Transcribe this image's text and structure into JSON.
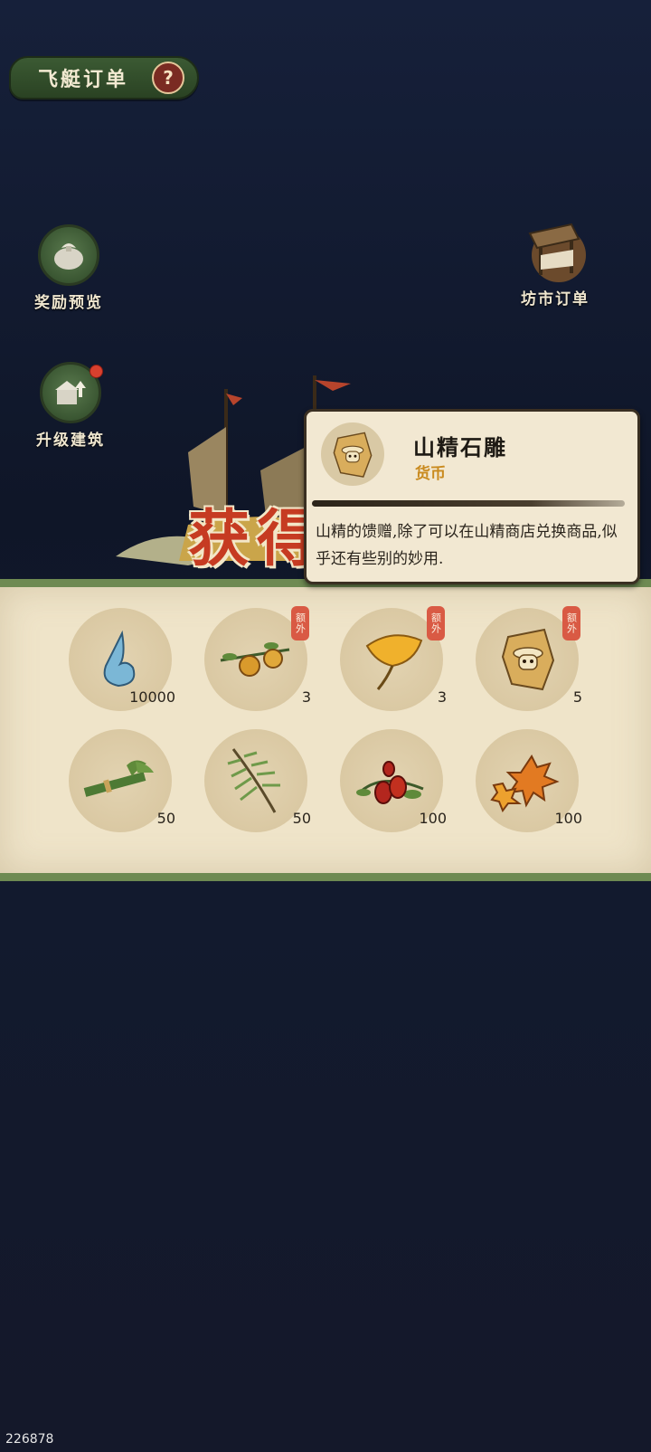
{
  "header": {
    "title": "飞艇订单",
    "help_symbol": "?"
  },
  "side_buttons": {
    "reward_preview": "奖励预览",
    "upgrade_building": "升级建筑",
    "market_orders": "坊市订单"
  },
  "banner": {
    "text": "获得"
  },
  "tooltip": {
    "item_name": "山精石雕",
    "item_type": "货币",
    "description": "山精的馈赠,除了可以在山精商店兑换商品,似乎还有些别的妙用."
  },
  "rewards": [
    {
      "icon": "water-drop-icon",
      "quantity": "10000",
      "extra": ""
    },
    {
      "icon": "fruit-branch-icon",
      "quantity": "3",
      "extra": "额外"
    },
    {
      "icon": "ginkgo-leaf-icon",
      "quantity": "3",
      "extra": "额外"
    },
    {
      "icon": "stone-carving-icon",
      "quantity": "5",
      "extra": "额外"
    },
    {
      "icon": "herb-bundle-icon",
      "quantity": "50",
      "extra": ""
    },
    {
      "icon": "pine-branch-icon",
      "quantity": "50",
      "extra": ""
    },
    {
      "icon": "red-dates-icon",
      "quantity": "100",
      "extra": ""
    },
    {
      "icon": "maple-leaves-icon",
      "quantity": "100",
      "extra": ""
    }
  ],
  "footer": {
    "id": "226878"
  },
  "colors": {
    "accent_green": "#6e8a52",
    "badge_red": "#d95a44",
    "currency_gold": "#c98a1e"
  }
}
